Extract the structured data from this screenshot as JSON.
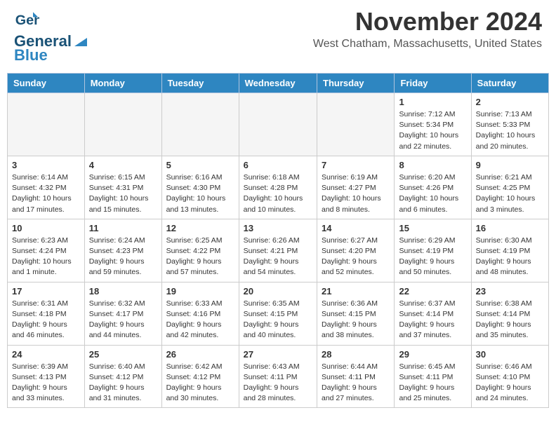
{
  "header": {
    "logo_general": "General",
    "logo_blue": "Blue",
    "month_title": "November 2024",
    "location": "West Chatham, Massachusetts, United States"
  },
  "weekdays": [
    "Sunday",
    "Monday",
    "Tuesday",
    "Wednesday",
    "Thursday",
    "Friday",
    "Saturday"
  ],
  "weeks": [
    [
      {
        "day": "",
        "info": ""
      },
      {
        "day": "",
        "info": ""
      },
      {
        "day": "",
        "info": ""
      },
      {
        "day": "",
        "info": ""
      },
      {
        "day": "",
        "info": ""
      },
      {
        "day": "1",
        "info": "Sunrise: 7:12 AM\nSunset: 5:34 PM\nDaylight: 10 hours and 22 minutes."
      },
      {
        "day": "2",
        "info": "Sunrise: 7:13 AM\nSunset: 5:33 PM\nDaylight: 10 hours and 20 minutes."
      }
    ],
    [
      {
        "day": "3",
        "info": "Sunrise: 6:14 AM\nSunset: 4:32 PM\nDaylight: 10 hours and 17 minutes."
      },
      {
        "day": "4",
        "info": "Sunrise: 6:15 AM\nSunset: 4:31 PM\nDaylight: 10 hours and 15 minutes."
      },
      {
        "day": "5",
        "info": "Sunrise: 6:16 AM\nSunset: 4:30 PM\nDaylight: 10 hours and 13 minutes."
      },
      {
        "day": "6",
        "info": "Sunrise: 6:18 AM\nSunset: 4:28 PM\nDaylight: 10 hours and 10 minutes."
      },
      {
        "day": "7",
        "info": "Sunrise: 6:19 AM\nSunset: 4:27 PM\nDaylight: 10 hours and 8 minutes."
      },
      {
        "day": "8",
        "info": "Sunrise: 6:20 AM\nSunset: 4:26 PM\nDaylight: 10 hours and 6 minutes."
      },
      {
        "day": "9",
        "info": "Sunrise: 6:21 AM\nSunset: 4:25 PM\nDaylight: 10 hours and 3 minutes."
      }
    ],
    [
      {
        "day": "10",
        "info": "Sunrise: 6:23 AM\nSunset: 4:24 PM\nDaylight: 10 hours and 1 minute."
      },
      {
        "day": "11",
        "info": "Sunrise: 6:24 AM\nSunset: 4:23 PM\nDaylight: 9 hours and 59 minutes."
      },
      {
        "day": "12",
        "info": "Sunrise: 6:25 AM\nSunset: 4:22 PM\nDaylight: 9 hours and 57 minutes."
      },
      {
        "day": "13",
        "info": "Sunrise: 6:26 AM\nSunset: 4:21 PM\nDaylight: 9 hours and 54 minutes."
      },
      {
        "day": "14",
        "info": "Sunrise: 6:27 AM\nSunset: 4:20 PM\nDaylight: 9 hours and 52 minutes."
      },
      {
        "day": "15",
        "info": "Sunrise: 6:29 AM\nSunset: 4:19 PM\nDaylight: 9 hours and 50 minutes."
      },
      {
        "day": "16",
        "info": "Sunrise: 6:30 AM\nSunset: 4:19 PM\nDaylight: 9 hours and 48 minutes."
      }
    ],
    [
      {
        "day": "17",
        "info": "Sunrise: 6:31 AM\nSunset: 4:18 PM\nDaylight: 9 hours and 46 minutes."
      },
      {
        "day": "18",
        "info": "Sunrise: 6:32 AM\nSunset: 4:17 PM\nDaylight: 9 hours and 44 minutes."
      },
      {
        "day": "19",
        "info": "Sunrise: 6:33 AM\nSunset: 4:16 PM\nDaylight: 9 hours and 42 minutes."
      },
      {
        "day": "20",
        "info": "Sunrise: 6:35 AM\nSunset: 4:15 PM\nDaylight: 9 hours and 40 minutes."
      },
      {
        "day": "21",
        "info": "Sunrise: 6:36 AM\nSunset: 4:15 PM\nDaylight: 9 hours and 38 minutes."
      },
      {
        "day": "22",
        "info": "Sunrise: 6:37 AM\nSunset: 4:14 PM\nDaylight: 9 hours and 37 minutes."
      },
      {
        "day": "23",
        "info": "Sunrise: 6:38 AM\nSunset: 4:14 PM\nDaylight: 9 hours and 35 minutes."
      }
    ],
    [
      {
        "day": "24",
        "info": "Sunrise: 6:39 AM\nSunset: 4:13 PM\nDaylight: 9 hours and 33 minutes."
      },
      {
        "day": "25",
        "info": "Sunrise: 6:40 AM\nSunset: 4:12 PM\nDaylight: 9 hours and 31 minutes."
      },
      {
        "day": "26",
        "info": "Sunrise: 6:42 AM\nSunset: 4:12 PM\nDaylight: 9 hours and 30 minutes."
      },
      {
        "day": "27",
        "info": "Sunrise: 6:43 AM\nSunset: 4:11 PM\nDaylight: 9 hours and 28 minutes."
      },
      {
        "day": "28",
        "info": "Sunrise: 6:44 AM\nSunset: 4:11 PM\nDaylight: 9 hours and 27 minutes."
      },
      {
        "day": "29",
        "info": "Sunrise: 6:45 AM\nSunset: 4:11 PM\nDaylight: 9 hours and 25 minutes."
      },
      {
        "day": "30",
        "info": "Sunrise: 6:46 AM\nSunset: 4:10 PM\nDaylight: 9 hours and 24 minutes."
      }
    ]
  ]
}
